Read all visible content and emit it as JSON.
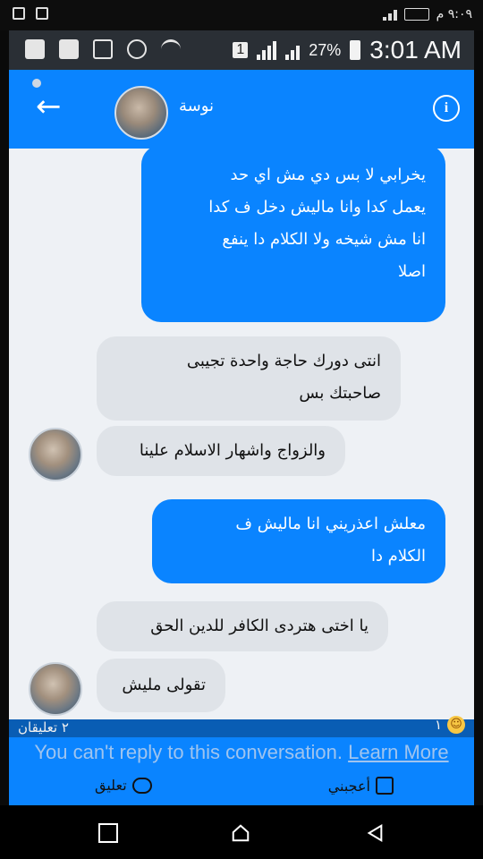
{
  "outer_status": {
    "time": "٩:٠٩ م",
    "left_icons": [
      "shield-icon",
      "image-icon"
    ],
    "right_icons": [
      "battery-icon",
      "signal-icon"
    ]
  },
  "inner_status": {
    "time": "3:01 AM",
    "battery_percent": "27%",
    "sim_number": "1",
    "left_icons": [
      "plus-icon",
      "facebook-icon",
      "mute-icon",
      "alarm-icon",
      "wifi-icon"
    ]
  },
  "header": {
    "contact_name": "نوسة",
    "back_icon": "back-arrow-icon",
    "info_icon": "info-icon",
    "accent": "#0a84ff"
  },
  "messages": [
    {
      "direction": "outgoing",
      "text": "يخرابي لا بس دي مش اي حد\nيعمل كدا وانا ماليش دخل ف كدا\nانا مش شيخه ولا الكلام دا ينفع\nاصلا"
    },
    {
      "direction": "incoming",
      "text": "انتى دورك حاجة واحدة تجيبى\nصاحبتك بس"
    },
    {
      "direction": "incoming",
      "text": "والزواج واشهار الاسلام علينا"
    },
    {
      "direction": "outgoing",
      "text": "معلش اعذريني انا ماليش ف\nالكلام دا"
    },
    {
      "direction": "incoming",
      "text": "يا  اختى هتردى الكافر للدين الحق"
    },
    {
      "direction": "incoming",
      "text": "تقولى مليش"
    }
  ],
  "footer": {
    "notice": "You can't reply to this conversation.",
    "learn_more": "Learn More",
    "comments_count": "٢ تعليقان",
    "reaction_count": "١",
    "like_label": "أعجبني",
    "comment_label": "تعليق"
  },
  "navbar": {
    "icons": [
      "recent-apps-icon",
      "home-icon",
      "back-icon"
    ]
  }
}
